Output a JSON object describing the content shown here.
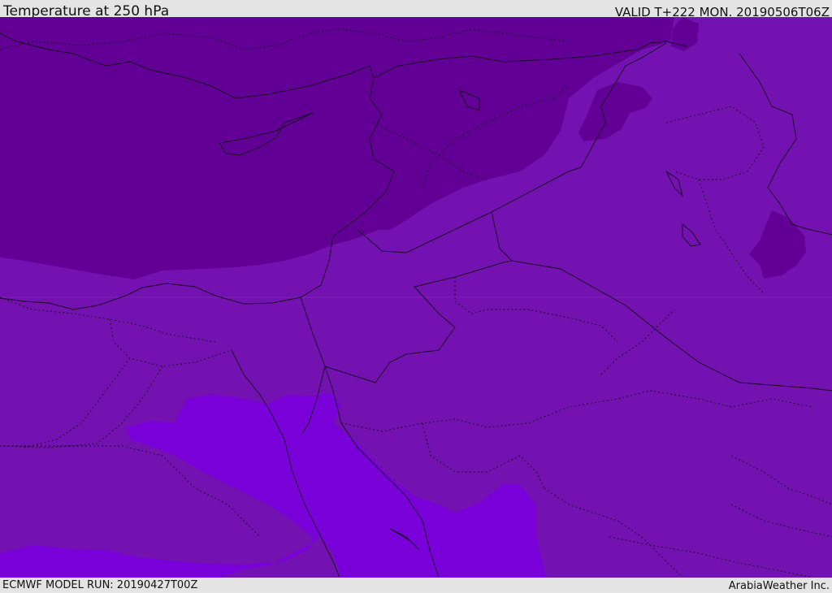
{
  "header": {
    "title": "Temperature at 250 hPa",
    "valid_time": "VALID T+222 MON. 20190506T06Z"
  },
  "footer": {
    "model_run": "ECMWF MODEL RUN: 20190427T00Z",
    "credit": "ArabiaWeather Inc."
  },
  "map": {
    "colors": {
      "dark_band": "#620096",
      "mid_band": "#7411b1",
      "warm_band": "#7a00da",
      "border_line": "#1a0026"
    }
  }
}
